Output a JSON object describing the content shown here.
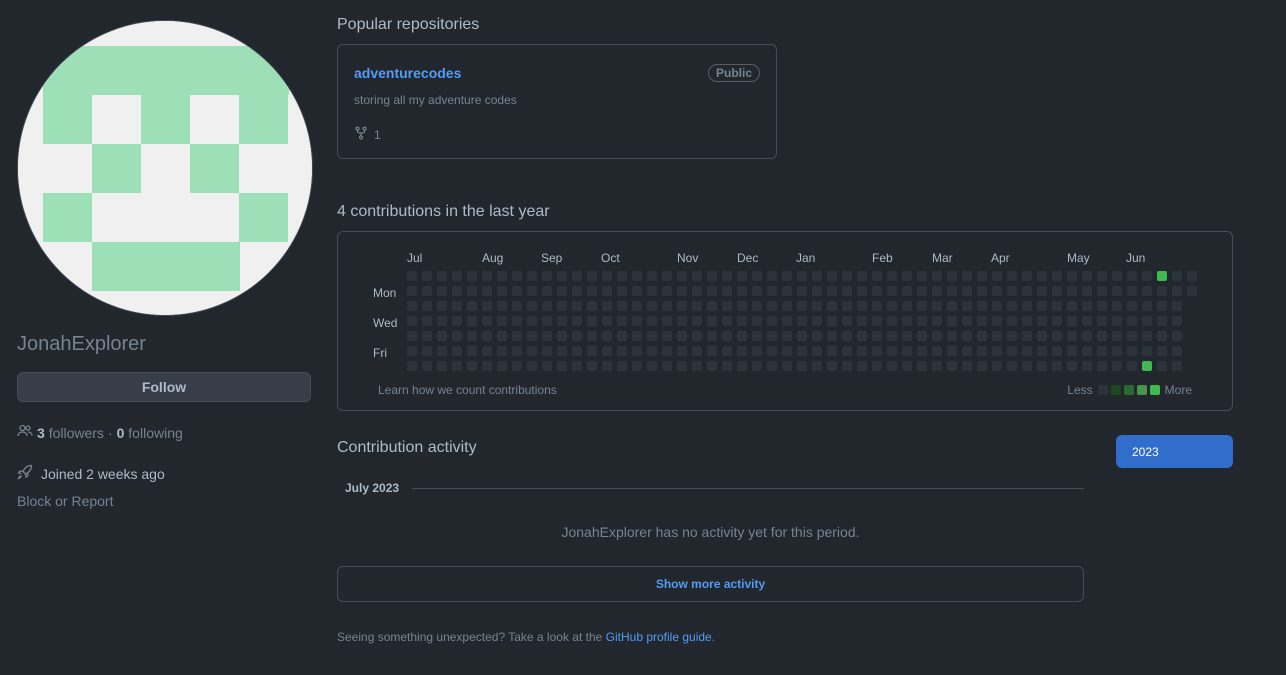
{
  "profile": {
    "username": "JonahExplorer",
    "follow_label": "Follow",
    "followers_count": "3",
    "followers_label": "followers",
    "separator": "·",
    "following_count": "0",
    "following_label": "following",
    "joined_text": "Joined 2 weeks ago",
    "block_report": "Block or Report"
  },
  "popular": {
    "title": "Popular repositories",
    "repos": [
      {
        "name": "adventurecodes",
        "badge": "Public",
        "description": "storing all my adventure codes",
        "forks": "1"
      }
    ]
  },
  "contributions": {
    "title": "4 contributions in the last year",
    "months": [
      "Jul",
      "Aug",
      "Sep",
      "Oct",
      "Nov",
      "Dec",
      "Jan",
      "Feb",
      "Mar",
      "Apr",
      "May",
      "Jun"
    ],
    "days": [
      "Mon",
      "Wed",
      "Fri"
    ],
    "learn": "Learn how we count contributions",
    "less": "Less",
    "more": "More",
    "colors": {
      "empty": "#2d333b",
      "l1": "#1b4721",
      "l2": "#2b6a30",
      "l3": "#46954a",
      "l4": "#6bc46d",
      "accent": "#3fb950"
    },
    "active_cells": [
      {
        "week": 50,
        "day": 0,
        "level": 4
      },
      {
        "week": 49,
        "day": 6,
        "level": 4
      }
    ]
  },
  "activity": {
    "title": "Contribution activity",
    "year": "2023",
    "month": "July 2023",
    "empty_message": "JonahExplorer has no activity yet for this period.",
    "show_more": "Show more activity",
    "footer_prefix": "Seeing something unexpected? Take a look at the",
    "footer_link": "GitHub profile guide",
    "footer_suffix": "."
  }
}
